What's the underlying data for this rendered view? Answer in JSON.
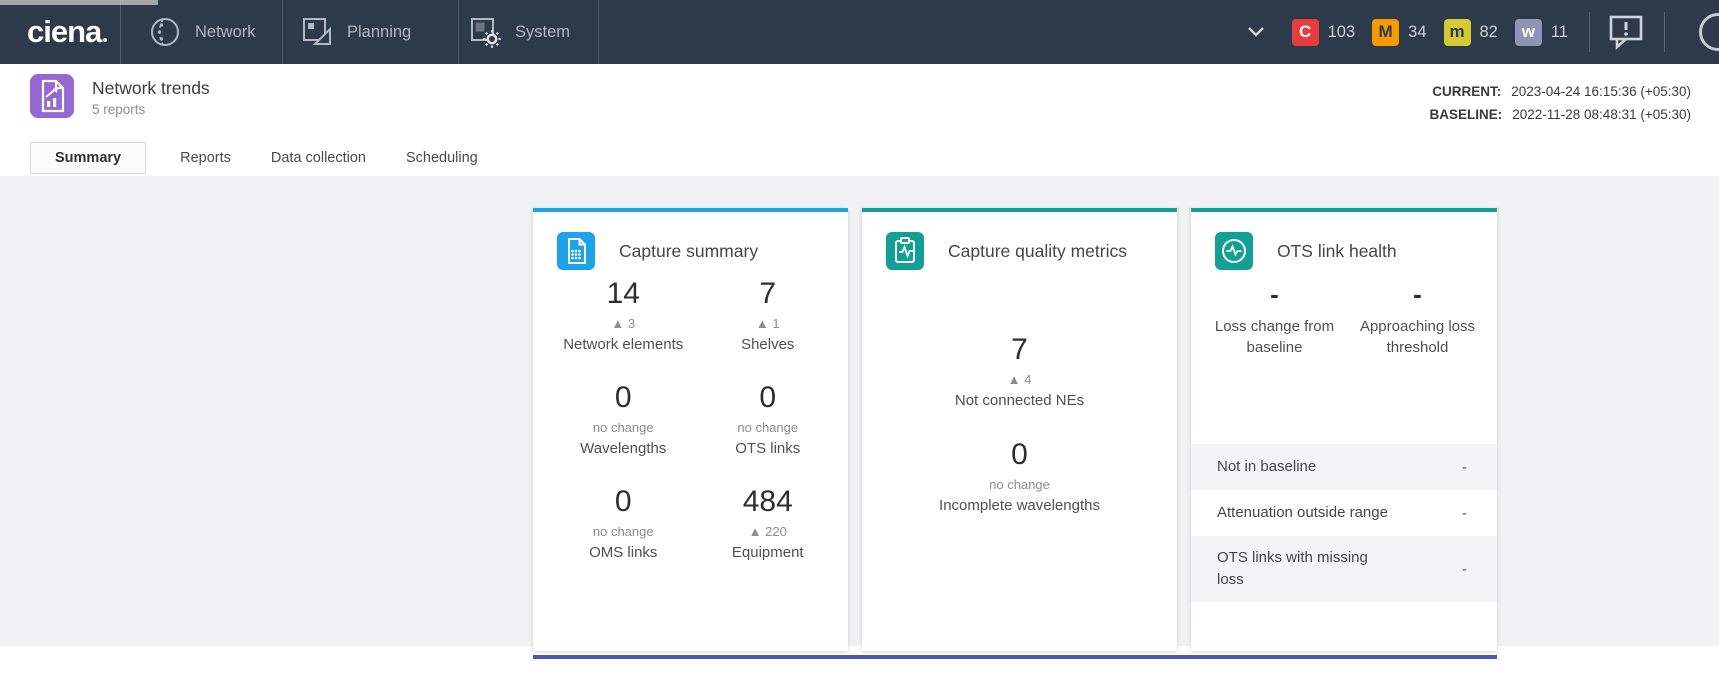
{
  "topbar": {
    "logo": "ciena",
    "nav": [
      {
        "label": "Network",
        "icon": "globe-icon"
      },
      {
        "label": "Planning",
        "icon": "planning-icon"
      },
      {
        "label": "System",
        "icon": "system-gear-icon"
      }
    ],
    "alarm_badges": [
      {
        "severity": "critical",
        "letter": "C",
        "count": "103",
        "color": "#e53c3c"
      },
      {
        "severity": "major",
        "letter": "M",
        "count": "34",
        "color": "#f59b00"
      },
      {
        "severity": "minor",
        "letter": "m",
        "count": "82",
        "color": "#d4ca35"
      },
      {
        "severity": "warning",
        "letter": "w",
        "count": "11",
        "color": "#9095b8"
      }
    ]
  },
  "header": {
    "title": "Network trends",
    "subtitle": "5 reports",
    "current_label": "CURRENT:",
    "current_value": "2023-04-24 16:15:36 (+05:30)",
    "baseline_label": "BASELINE:",
    "baseline_value": "2022-11-28 08:48:31 (+05:30)"
  },
  "tabs": [
    {
      "label": "Summary",
      "active": true
    },
    {
      "label": "Reports",
      "active": false
    },
    {
      "label": "Data collection",
      "active": false
    },
    {
      "label": "Scheduling",
      "active": false
    }
  ],
  "cards": [
    {
      "title": "Capture summary",
      "icon": "capture-summary-icon",
      "accent_color": "#1da3e8",
      "stats": [
        {
          "value": "14",
          "change": "▲ 3",
          "label": "Network elements"
        },
        {
          "value": "7",
          "change": "▲ 1",
          "label": "Shelves"
        },
        {
          "value": "0",
          "change": "no change",
          "label": "Wavelengths"
        },
        {
          "value": "0",
          "change": "no change",
          "label": "OTS links"
        },
        {
          "value": "0",
          "change": "no change",
          "label": "OMS links"
        },
        {
          "value": "484",
          "change": "▲ 220",
          "label": "Equipment"
        }
      ]
    },
    {
      "title": "Capture quality metrics",
      "icon": "quality-metrics-icon",
      "accent_color": "#13a094",
      "stats": [
        {
          "value": "7",
          "change": "▲ 4",
          "label": "Not connected NEs"
        },
        {
          "value": "0",
          "change": "no change",
          "label": "Incomplete wavelengths"
        }
      ]
    },
    {
      "title": "OTS link health",
      "icon": "link-health-icon",
      "accent_color": "#13a094",
      "stats": [
        {
          "value": "-",
          "label": "Loss change from baseline"
        },
        {
          "value": "-",
          "label": "Approaching loss threshold"
        }
      ],
      "rows": [
        {
          "label": "Not in baseline",
          "value": "-"
        },
        {
          "label": "Attenuation outside range",
          "value": "-"
        },
        {
          "label": "OTS links with missing loss",
          "value": "-"
        }
      ]
    }
  ]
}
